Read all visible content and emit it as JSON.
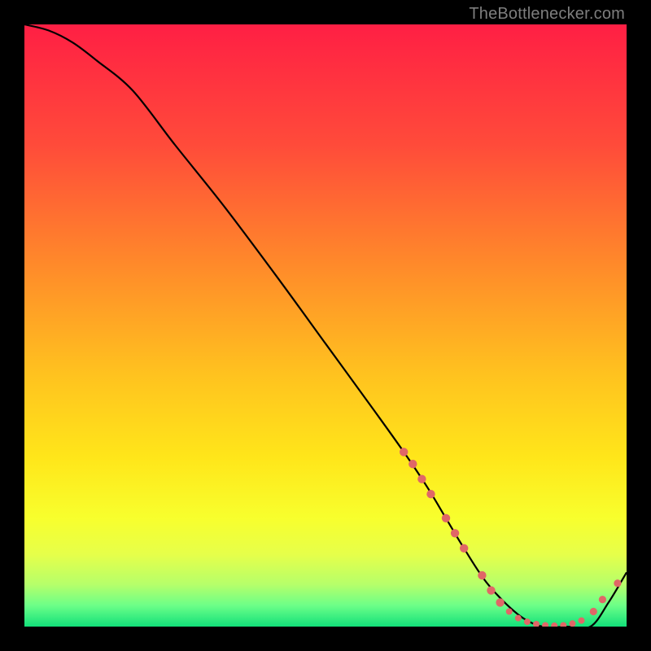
{
  "attribution": "TheBottlenecker.com",
  "colors": {
    "accent_marker": "#e06767",
    "curve": "#000000",
    "gradient_stops": [
      {
        "offset": 0,
        "color": "#ff1f44"
      },
      {
        "offset": 0.2,
        "color": "#ff4b3a"
      },
      {
        "offset": 0.4,
        "color": "#ff8a2a"
      },
      {
        "offset": 0.58,
        "color": "#ffc21f"
      },
      {
        "offset": 0.72,
        "color": "#ffe61a"
      },
      {
        "offset": 0.82,
        "color": "#f8ff2d"
      },
      {
        "offset": 0.88,
        "color": "#e6ff4a"
      },
      {
        "offset": 0.93,
        "color": "#b6ff6a"
      },
      {
        "offset": 0.965,
        "color": "#6cff88"
      },
      {
        "offset": 1.0,
        "color": "#12e07a"
      }
    ]
  },
  "chart_data": {
    "type": "line",
    "title": "",
    "xlabel": "",
    "ylabel": "",
    "xlim": [
      0,
      100
    ],
    "ylim": [
      0,
      100
    ],
    "grid": false,
    "legend": false,
    "series": [
      {
        "name": "bottleneck-curve",
        "x": [
          0,
          4,
          8,
          12,
          18,
          25,
          33,
          42,
          50,
          58,
          63,
          67,
          70,
          73,
          77,
          82,
          86,
          90,
          94,
          97,
          100
        ],
        "y": [
          100,
          99,
          97,
          94,
          89,
          80,
          70,
          58,
          47,
          36,
          29,
          23,
          18,
          13,
          7,
          2,
          0,
          0,
          0,
          4,
          9
        ]
      }
    ],
    "markers": [
      {
        "x": 63,
        "y": 29
      },
      {
        "x": 64.5,
        "y": 27
      },
      {
        "x": 66,
        "y": 24.5
      },
      {
        "x": 67.5,
        "y": 22
      },
      {
        "x": 70,
        "y": 18
      },
      {
        "x": 71.5,
        "y": 15.5
      },
      {
        "x": 73,
        "y": 13
      },
      {
        "x": 76,
        "y": 8.5
      },
      {
        "x": 77.5,
        "y": 6
      },
      {
        "x": 79,
        "y": 4
      },
      {
        "x": 80.5,
        "y": 2.5
      },
      {
        "x": 82,
        "y": 1.4
      },
      {
        "x": 83.5,
        "y": 0.8
      },
      {
        "x": 85,
        "y": 0.4
      },
      {
        "x": 86.5,
        "y": 0.2
      },
      {
        "x": 88,
        "y": 0.15
      },
      {
        "x": 89.5,
        "y": 0.2
      },
      {
        "x": 91,
        "y": 0.5
      },
      {
        "x": 92.5,
        "y": 1.0
      },
      {
        "x": 94.5,
        "y": 2.5
      },
      {
        "x": 96,
        "y": 4.5
      },
      {
        "x": 98.5,
        "y": 7.2
      }
    ]
  }
}
